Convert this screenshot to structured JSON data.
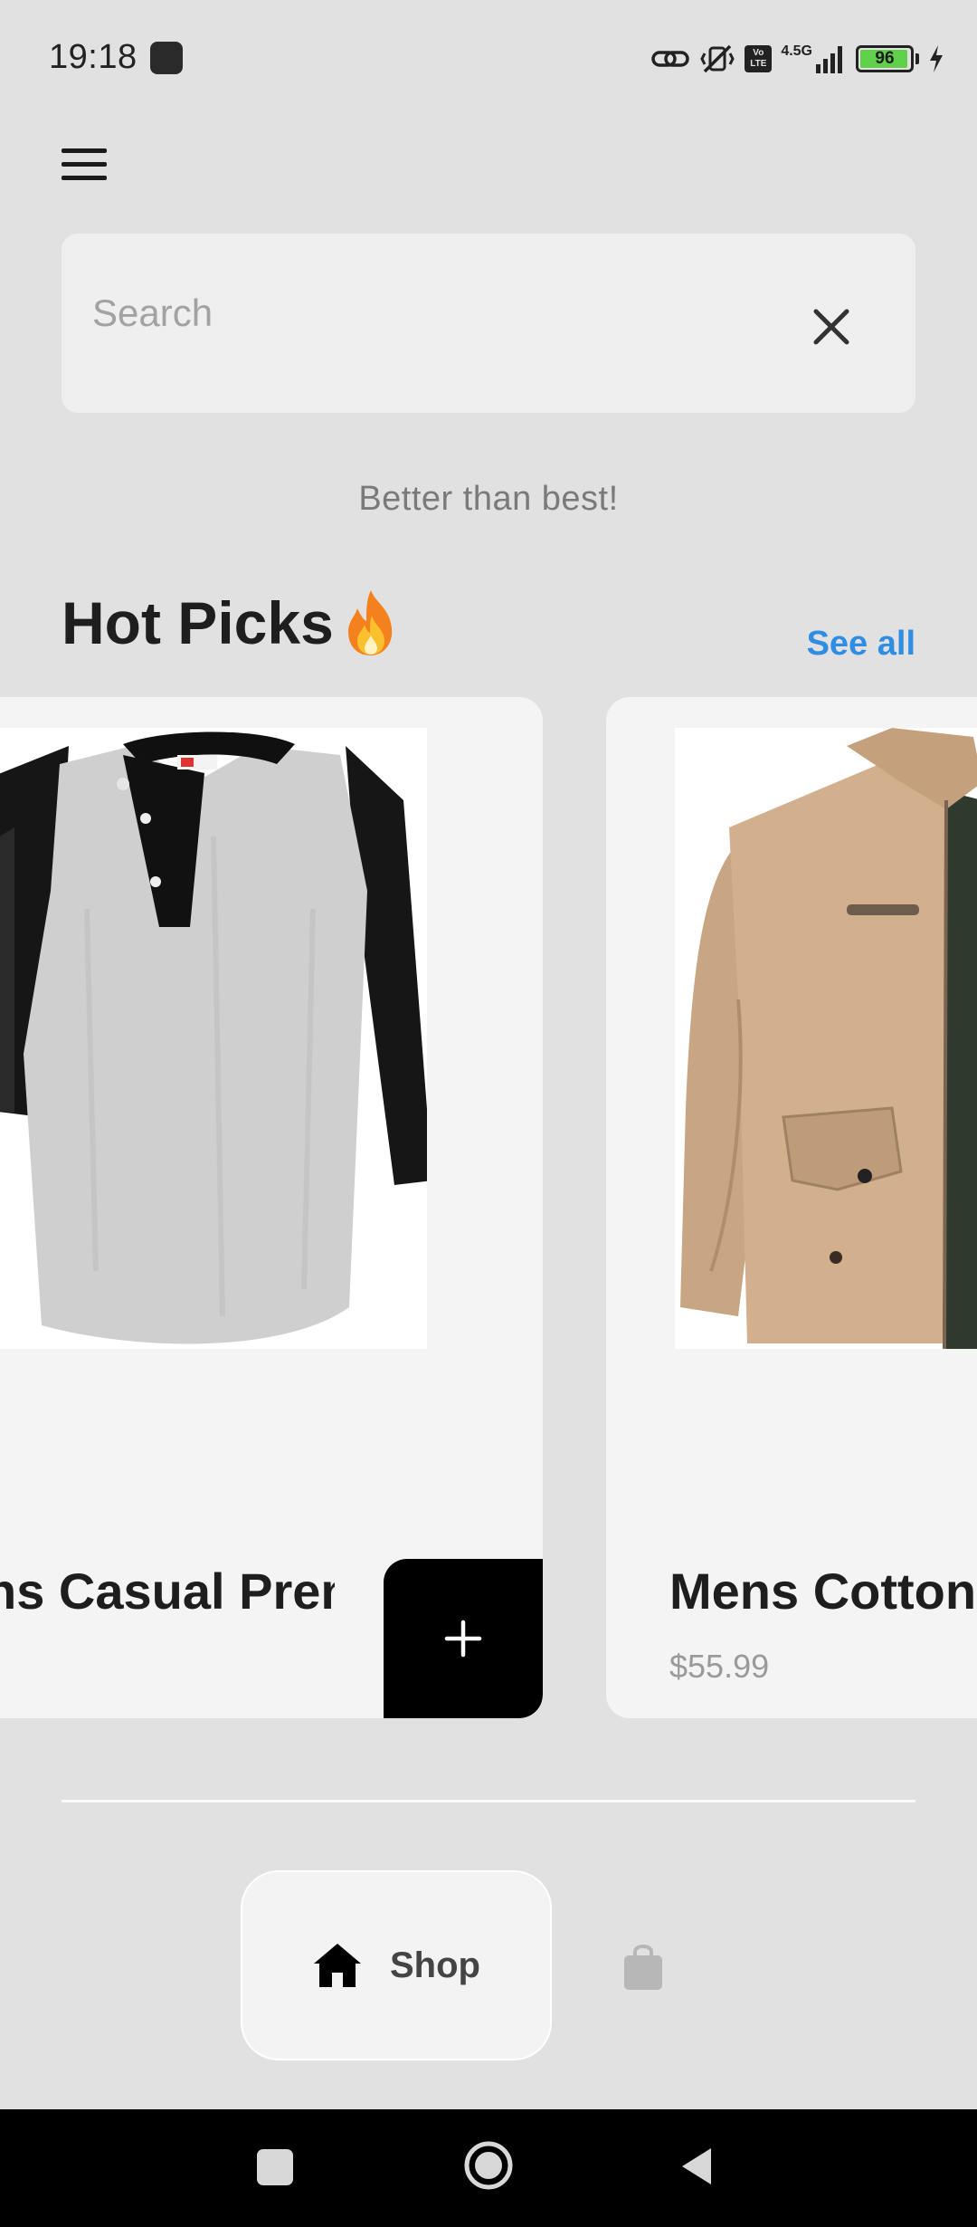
{
  "status_bar": {
    "time": "19:18",
    "network_label": "4.5G",
    "volte_label": "Vo LTE",
    "battery": "96",
    "battery_level": 0.96,
    "icons": [
      "link-icon",
      "vibrate-off-icon",
      "volte-icon",
      "signal-icon",
      "battery-icon",
      "charging-icon"
    ]
  },
  "header": {
    "menu_icon": "hamburger-menu-icon"
  },
  "search": {
    "placeholder": "Search",
    "value": "",
    "clear_icon": "close-icon"
  },
  "tagline": "Better than best!",
  "section": {
    "title": "Hot Picks",
    "title_icon": "fire-icon",
    "see_all_label": "See all"
  },
  "products": [
    {
      "name": "Mens Casual Premium Slim Fit T-Shirts",
      "visible_name": "ns Casual Premi",
      "price": "",
      "image": "raglan-henley-shirt",
      "action_icon": "plus-icon"
    },
    {
      "name": "Mens Cotton Jacket",
      "visible_name": "Mens Cotton J",
      "price": "$55.99",
      "image": "khaki-jacket"
    }
  ],
  "bottom_nav": {
    "items": [
      {
        "label": "Shop",
        "icon": "home-icon",
        "active": true
      },
      {
        "label": "",
        "icon": "shopping-bag-icon",
        "active": false
      }
    ]
  },
  "system_nav": {
    "icons": [
      "recents-icon",
      "home-circle-icon",
      "back-icon"
    ]
  },
  "colors": {
    "background": "#e1e1e1",
    "accent": "#2f8de4",
    "card": "#f4f4f4",
    "add_button": "#000000",
    "battery": "#5fd04a"
  }
}
